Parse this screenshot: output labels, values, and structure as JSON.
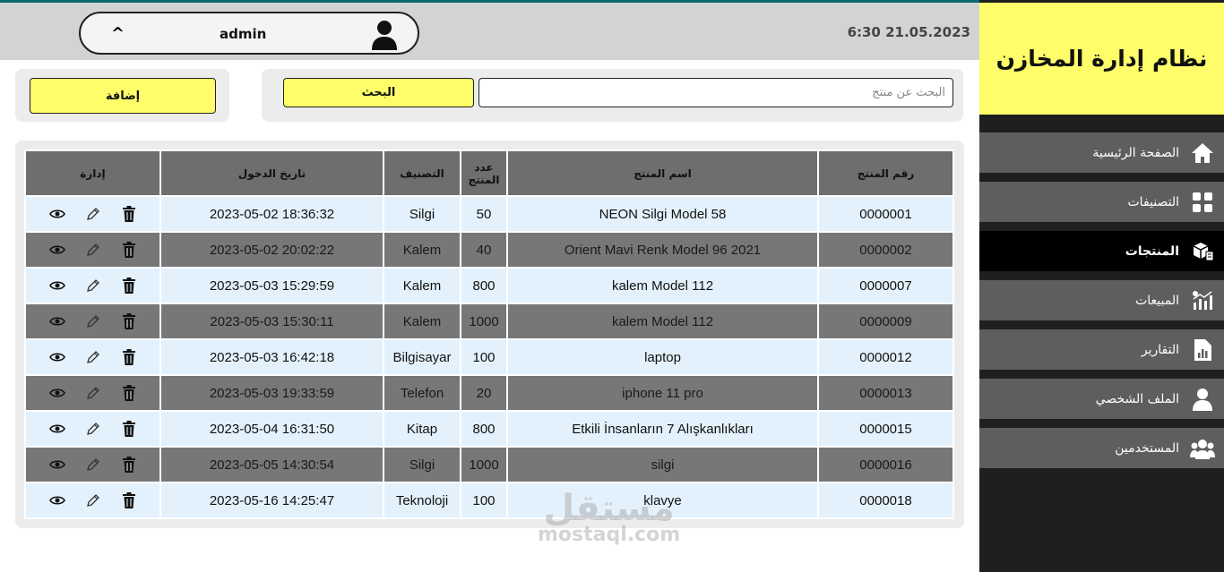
{
  "app": {
    "title": "نظام إدارة المخازن"
  },
  "header": {
    "datetime": "6:30 21.05.2023",
    "username": "admin",
    "caret": "^"
  },
  "sidebar": {
    "items": [
      {
        "label": "الصفحة الرئيسية",
        "icon": "home-icon",
        "active": false
      },
      {
        "label": "التصنيفات",
        "icon": "grid-icon",
        "active": false
      },
      {
        "label": "المنتجات",
        "icon": "boxes-icon",
        "active": true
      },
      {
        "label": "المبيعات",
        "icon": "sales-chart-icon",
        "active": false
      },
      {
        "label": "التقارير",
        "icon": "report-icon",
        "active": false
      },
      {
        "label": "الملف الشخصي",
        "icon": "user-icon",
        "active": false
      },
      {
        "label": "المستخدمين",
        "icon": "users-icon",
        "active": false
      }
    ]
  },
  "toolbar": {
    "add_label": "إضافة",
    "search_label": "البحث",
    "search_placeholder": "البحث عن منتج"
  },
  "table": {
    "headers": [
      "رقم المنتج",
      "اسم المنتج",
      "عدد المنتج",
      "التصنيف",
      "تاريخ الدخول",
      "إدارة"
    ],
    "rows": [
      [
        "0000001",
        "NEON Silgi Model 58",
        "50",
        "Silgi",
        "2023-05-02 18:36:32"
      ],
      [
        "0000002",
        "Orient Mavi Renk Model 96 2021",
        "40",
        "Kalem",
        "2023-05-02 20:02:22"
      ],
      [
        "0000007",
        "kalem Model 112",
        "800",
        "Kalem",
        "2023-05-03 15:29:59"
      ],
      [
        "0000009",
        "kalem Model 112",
        "1000",
        "Kalem",
        "2023-05-03 15:30:11"
      ],
      [
        "0000012",
        "laptop",
        "100",
        "Bilgisayar",
        "2023-05-03 16:42:18"
      ],
      [
        "0000013",
        "iphone 11 pro",
        "20",
        "Telefon",
        "2023-05-03 19:33:59"
      ],
      [
        "0000015",
        "Etkili İnsanların 7 Alışkanlıkları",
        "800",
        "Kitap",
        "2023-05-04 16:31:50"
      ],
      [
        "0000016",
        "silgi",
        "1000",
        "Silgi",
        "2023-05-05 14:30:54"
      ],
      [
        "0000018",
        "klavye",
        "100",
        "Teknoloji",
        "2023-05-16 14:25:47"
      ]
    ]
  },
  "watermark": {
    "arabic": "مستقل",
    "latin": "mostaql.com"
  },
  "colors": {
    "accent_yellow": "#fffe6a",
    "sidebar_bg": "#1f1f1f",
    "nav_bg": "#5e5e5e",
    "row_light": "#e3f1fc",
    "row_dark": "#777777"
  }
}
